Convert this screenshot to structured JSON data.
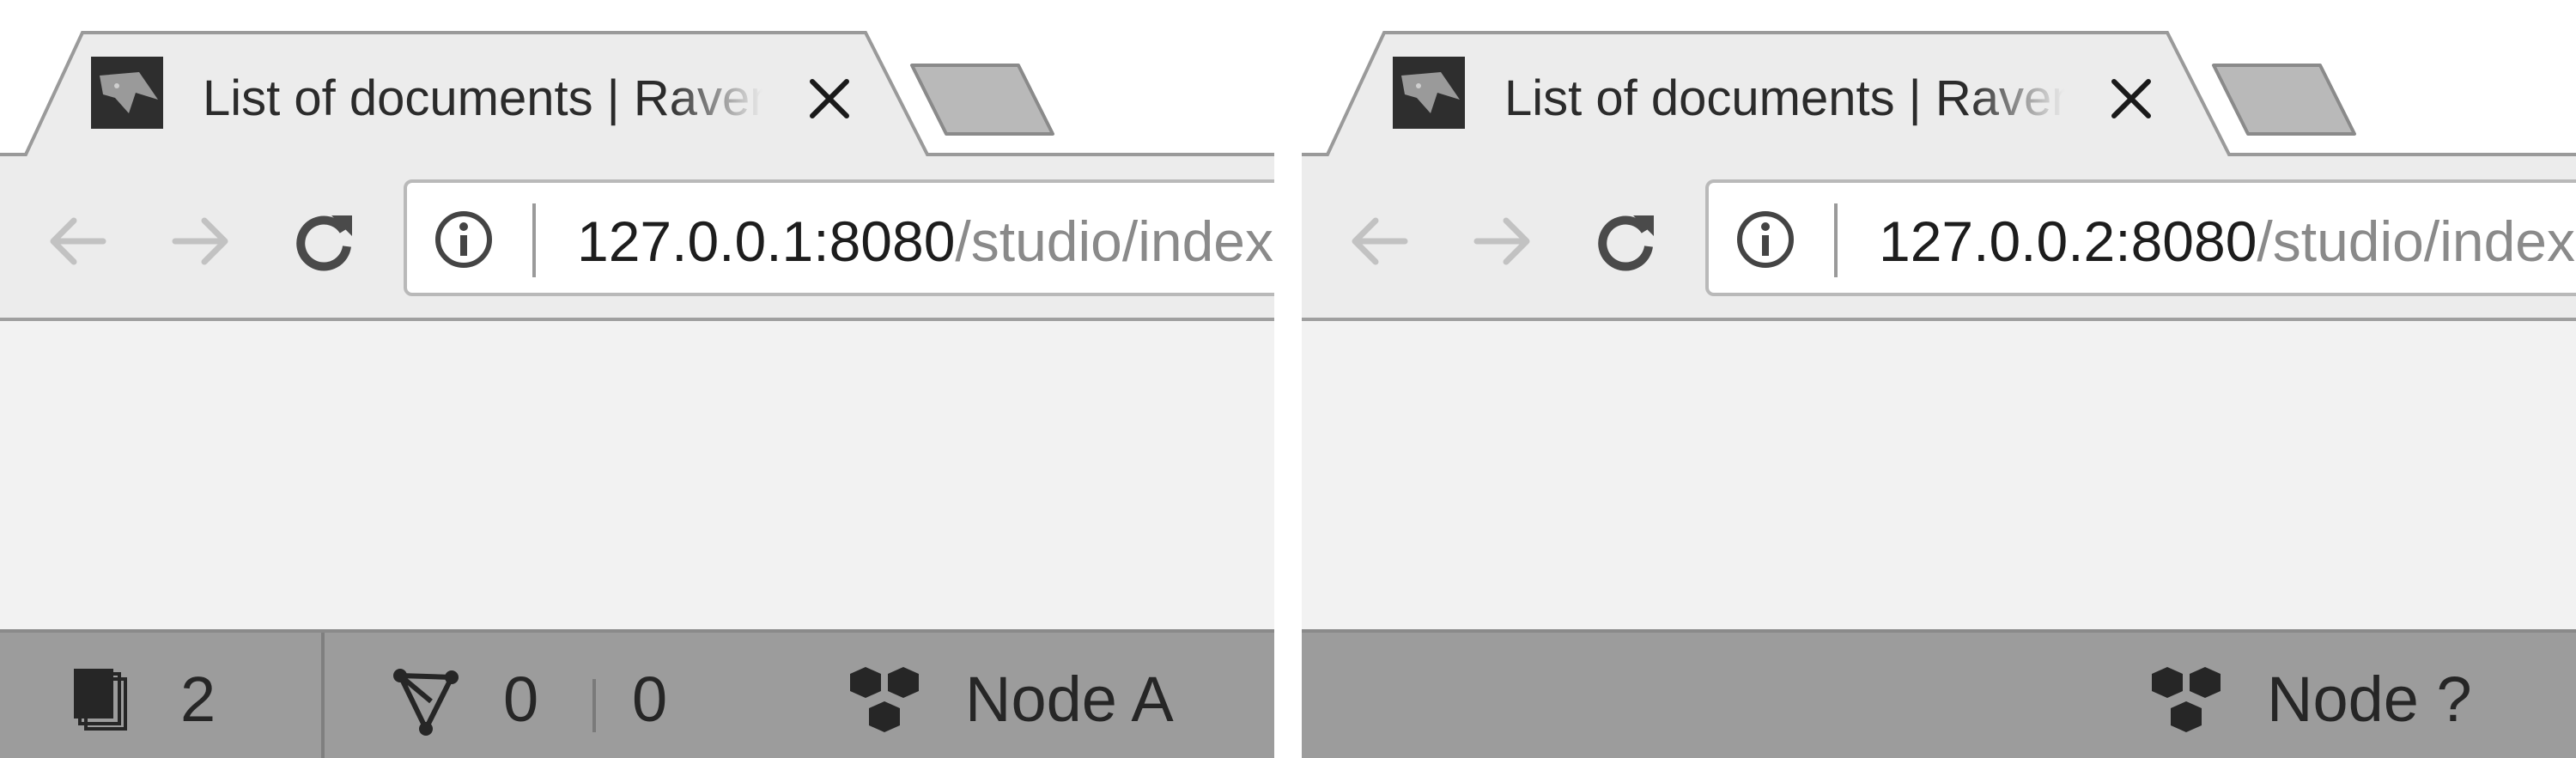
{
  "windows": [
    {
      "tab": {
        "title": "List of documents | RavenDB",
        "favicon": "raven-icon",
        "close": "close-icon"
      },
      "toolbar": {
        "back": "arrow-left-icon",
        "forward": "arrow-right-icon",
        "reload": "reload-icon",
        "info": "info-icon",
        "url_host": "127.0.0.1:8080",
        "url_path": "/studio/index.html#databases"
      },
      "statusbar": {
        "documents_count": "2",
        "indexes_count": "0",
        "indexes_stale": "0",
        "node_label": "Node A"
      }
    },
    {
      "tab": {
        "title": "List of documents | RavenDB",
        "favicon": "raven-icon",
        "close": "close-icon"
      },
      "toolbar": {
        "back": "arrow-left-icon",
        "forward": "arrow-right-icon",
        "reload": "reload-icon",
        "info": "info-icon",
        "url_host": "127.0.0.2:8080",
        "url_path": "/studio/index.html#databases"
      },
      "statusbar": {
        "node_label": "Node ?"
      }
    }
  ],
  "colors": {
    "page": "#ffffff",
    "toolbar": "#ececec",
    "content": "#f2f2f2",
    "statusbar": "#9c9c9c",
    "text": "#262626"
  }
}
